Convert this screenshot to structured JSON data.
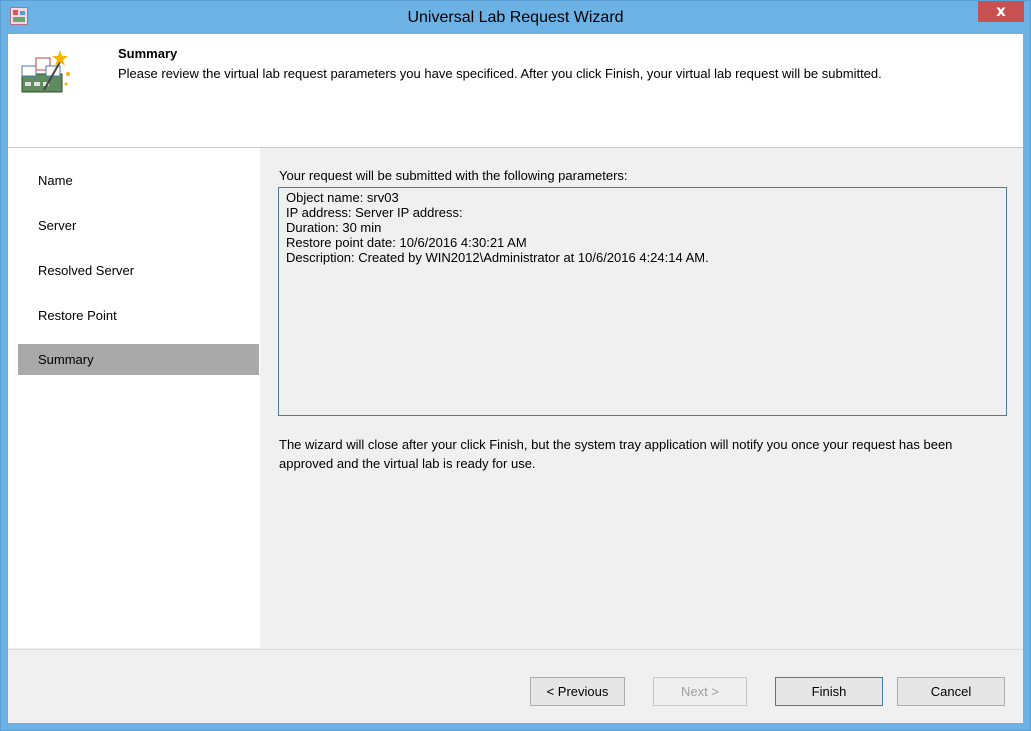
{
  "window": {
    "title": "Universal Lab Request Wizard",
    "close_glyph": "x",
    "icon": "app-icon",
    "accent_color": "#6cb2e4"
  },
  "header": {
    "title": "Summary",
    "description": "Please review the virtual lab request parameters you have specificed. After you click Finish, your virtual lab request will be submitted.",
    "icon": "wizard-icon"
  },
  "sidebar": {
    "items": [
      {
        "label": "Name",
        "active": false
      },
      {
        "label": "Server",
        "active": false
      },
      {
        "label": "Resolved Server",
        "active": false
      },
      {
        "label": "Restore Point",
        "active": false
      },
      {
        "label": "Summary",
        "active": true
      }
    ]
  },
  "main": {
    "intro": "Your request will be submitted with the following parameters:",
    "parameters": [
      "Object name: srv03",
      "IP address: Server IP address:",
      "Duration: 30 min",
      "Restore point date: 10/6/2016 4:30:21 AM",
      "Description: Created by WIN2012\\Administrator at 10/6/2016 4:24:14 AM."
    ],
    "note": "The wizard will close after your click Finish, but the system tray application will notify you once your request has been approved and the virtual lab is ready for use."
  },
  "footer": {
    "previous_label": "< Previous",
    "next_label": "Next >",
    "finish_label": "Finish",
    "cancel_label": "Cancel"
  }
}
